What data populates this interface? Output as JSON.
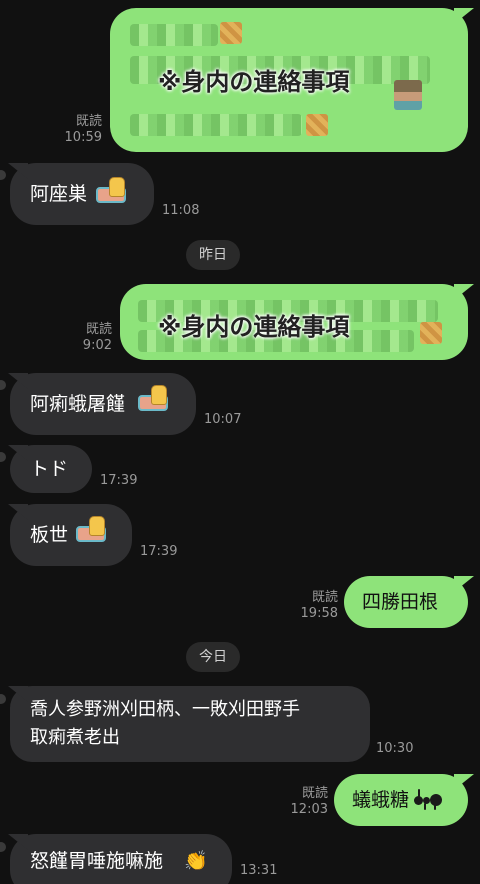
{
  "read_label": "既読",
  "date_dividers": {
    "yesterday": "昨日",
    "today": "今日"
  },
  "messages": {
    "m1": {
      "caption": "※身内の連絡事項",
      "time": "10:59"
    },
    "m2": {
      "text": "阿座巣",
      "time": "11:08"
    },
    "m3": {
      "caption": "※身内の連絡事項",
      "time": "9:02"
    },
    "m4": {
      "text": "阿痢蛾屠饉",
      "time": "10:07"
    },
    "m5": {
      "text": "トド",
      "time": "17:39"
    },
    "m6": {
      "text": "板世",
      "time": "17:39"
    },
    "m7": {
      "text": "四勝田根",
      "time": "19:58"
    },
    "m8": {
      "line1": "喬人参野洲刈田柄、一敗刈田野手",
      "line2": "取痢煮老出",
      "time": "10:30"
    },
    "m9": {
      "text": "蟻蛾糖",
      "time": "12:03"
    },
    "m10": {
      "text": "怒饉胃唾施嘛施",
      "time": "13:31"
    }
  },
  "emoji": {
    "raised_hand_sticker": "raised-hand-with-mat",
    "ant": "ant",
    "clap": "👏"
  },
  "colors": {
    "background": "#111111",
    "sent_bubble": "#8ee37a",
    "received_bubble": "#2f2f31"
  }
}
